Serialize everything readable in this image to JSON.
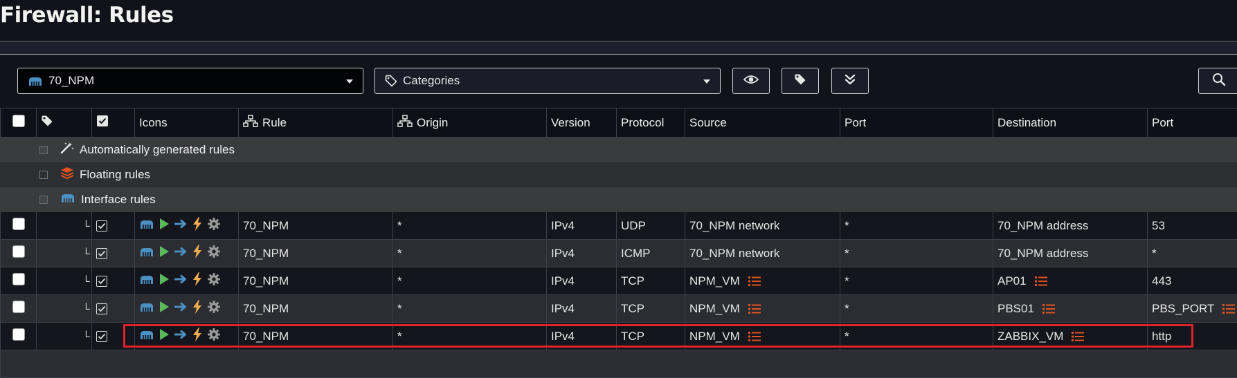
{
  "page": {
    "title": "Firewall: Rules"
  },
  "toolbar": {
    "interface_select": {
      "value": "70_NPM",
      "icon": "network-icon"
    },
    "category_select": {
      "value": "Categories",
      "icon": "tag-icon"
    },
    "buttons": [
      {
        "name": "show-hide-button",
        "icon": "eye-icon"
      },
      {
        "name": "tag-button",
        "icon": "tag-icon"
      },
      {
        "name": "expand-button",
        "icon": "double-chevron-down-icon"
      },
      {
        "name": "search-button",
        "icon": "search-icon"
      }
    ]
  },
  "table": {
    "headers": {
      "select": "",
      "category": "",
      "enabled": "",
      "icons": "Icons",
      "rule": "Rule",
      "origin": "Origin",
      "version": "Version",
      "protocol": "Protocol",
      "source": "Source",
      "source_port": "Port",
      "destination": "Destination",
      "destination_port": "Port"
    },
    "groups": [
      {
        "label": "Automatically generated rules",
        "icon": "magic-wand-icon"
      },
      {
        "label": "Floating rules",
        "icon": "layers-icon"
      },
      {
        "label": "Interface rules",
        "icon": "network-icon"
      }
    ],
    "rows": [
      {
        "tree": "└",
        "rule": "70_NPM",
        "origin": "*",
        "version": "IPv4",
        "protocol": "UDP",
        "source": "70_NPM network",
        "source_alias": false,
        "source_port": "*",
        "destination": "70_NPM address",
        "destination_alias": false,
        "destination_port": "53",
        "destination_port_alias": false
      },
      {
        "tree": "└",
        "rule": "70_NPM",
        "origin": "*",
        "version": "IPv4",
        "protocol": "ICMP",
        "source": "70_NPM network",
        "source_alias": false,
        "source_port": "*",
        "destination": "70_NPM address",
        "destination_alias": false,
        "destination_port": "*",
        "destination_port_alias": false
      },
      {
        "tree": "└",
        "rule": "70_NPM",
        "origin": "*",
        "version": "IPv4",
        "protocol": "TCP",
        "source": "NPM_VM",
        "source_alias": true,
        "source_port": "*",
        "destination": "AP01",
        "destination_alias": true,
        "destination_port": "443",
        "destination_port_alias": false
      },
      {
        "tree": "└",
        "rule": "70_NPM",
        "origin": "*",
        "version": "IPv4",
        "protocol": "TCP",
        "source": "NPM_VM",
        "source_alias": true,
        "source_port": "*",
        "destination": "PBS01",
        "destination_alias": true,
        "destination_port": "PBS_PORT",
        "destination_port_alias": true
      },
      {
        "tree": "└",
        "rule": "70_NPM",
        "origin": "*",
        "version": "IPv4",
        "protocol": "TCP",
        "source": "NPM_VM",
        "source_alias": true,
        "source_port": "*",
        "destination": "ZABBIX_VM",
        "destination_alias": true,
        "destination_port": "http",
        "destination_port_alias": false
      }
    ]
  },
  "colors": {
    "accent_blue": "#4a90c2",
    "play_green": "#5cb85c",
    "arrow_blue": "#4a90c2",
    "bolt_yellow": "#f0ad4e",
    "gear_gray": "#9a9a9a",
    "alias_red": "#e0531f",
    "highlight_red": "#e0222c"
  }
}
